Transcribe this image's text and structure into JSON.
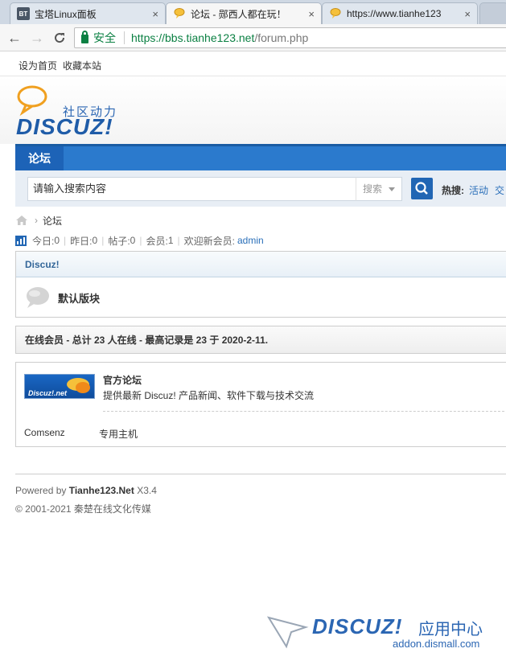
{
  "browser": {
    "tabs": [
      {
        "label": "宝塔Linux面板",
        "fav": "BT",
        "close": "×"
      },
      {
        "label": "论坛 - 郧西人都在玩！",
        "fav": "",
        "close": "×"
      },
      {
        "label": "https://www.tianhe123",
        "fav": "",
        "close": "×"
      }
    ],
    "secure_label": "安全",
    "url_host": "https://bbs.tianhe123.net",
    "url_path": "/forum.php"
  },
  "topbar": {
    "set_home": "设为首页",
    "bookmark": "收藏本站"
  },
  "logo": {
    "tagline": "社区动力",
    "brand": "DISCUZ!"
  },
  "nav": {
    "forum": "论坛"
  },
  "search": {
    "placeholder": "请输入搜索内容",
    "type": "搜索",
    "hot_label": "热搜:",
    "hot_1": "活动",
    "hot_2": "交"
  },
  "breadcrumb": {
    "current": "论坛",
    "separator": "›"
  },
  "stats": {
    "today_label": "今日:",
    "today": "0",
    "yesterday_label": "昨日:",
    "yesterday": "0",
    "posts_label": "帖子:",
    "posts": "0",
    "members_label": "会员:",
    "members": "1",
    "welcome_label": "欢迎新会员:",
    "new_member": "admin",
    "pipe": "|"
  },
  "category": {
    "title": "Discuz!",
    "forum_name": "默认版块"
  },
  "online": {
    "text": "在线会员 - 总计 23 人在线 - 最高记录是 23 于 2020-2-11."
  },
  "links": {
    "logo_text": "Discuz!.net",
    "title": "官方论坛",
    "desc": "提供最新 Discuz! 产品新闻、软件下载与技术交流",
    "link1": "Comsenz",
    "link2": "专用主机"
  },
  "footer": {
    "powered_prefix": "Powered by ",
    "site": "Tianhe123.Net",
    "version": " X3.4",
    "copyright": "© 2001-2021 秦楚在线文化传媒"
  },
  "watermark": {
    "brand": "DISCUZ!",
    "cn": "应用中心",
    "url": "addon.dismall.com"
  }
}
